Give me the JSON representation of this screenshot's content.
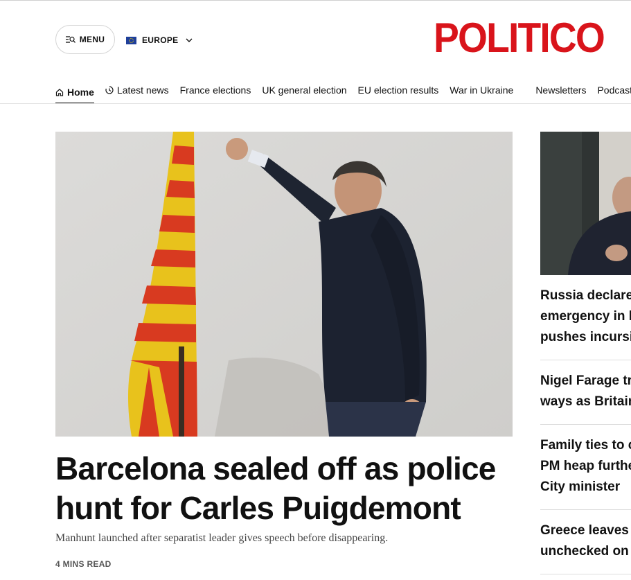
{
  "header": {
    "menu_label": "MENU",
    "edition_label": "EUROPE",
    "logo_text": "POLITICO",
    "brand_color": "#d9141b"
  },
  "nav": {
    "items": [
      {
        "label": "Home",
        "icon": "home-icon",
        "active": true
      },
      {
        "label": "Latest news",
        "icon": "clock-icon"
      },
      {
        "label": "France elections"
      },
      {
        "label": "UK general election"
      },
      {
        "label": "EU election results"
      },
      {
        "label": "War in Ukraine"
      },
      {
        "label": "Newsletters"
      },
      {
        "label": "Podcasts"
      }
    ]
  },
  "lead_story": {
    "headline": "Barcelona sealed off as police hunt for Carles Puigdemont",
    "dek": "Manhunt launched after separatist leader gives speech before disappearing.",
    "read_time": "4 MINS READ"
  },
  "sidebar": {
    "stories": [
      {
        "line1": "Russia declare",
        "line2": "emergency in k",
        "line3": "pushes incursi"
      },
      {
        "line1": "Nigel Farage tr",
        "line2": "ways as Britain"
      },
      {
        "line1": "Family ties to c",
        "line2": "PM heap furthe",
        "line3": "City minister"
      },
      {
        "line1": "Greece leaves",
        "line2": "unchecked on"
      }
    ]
  }
}
